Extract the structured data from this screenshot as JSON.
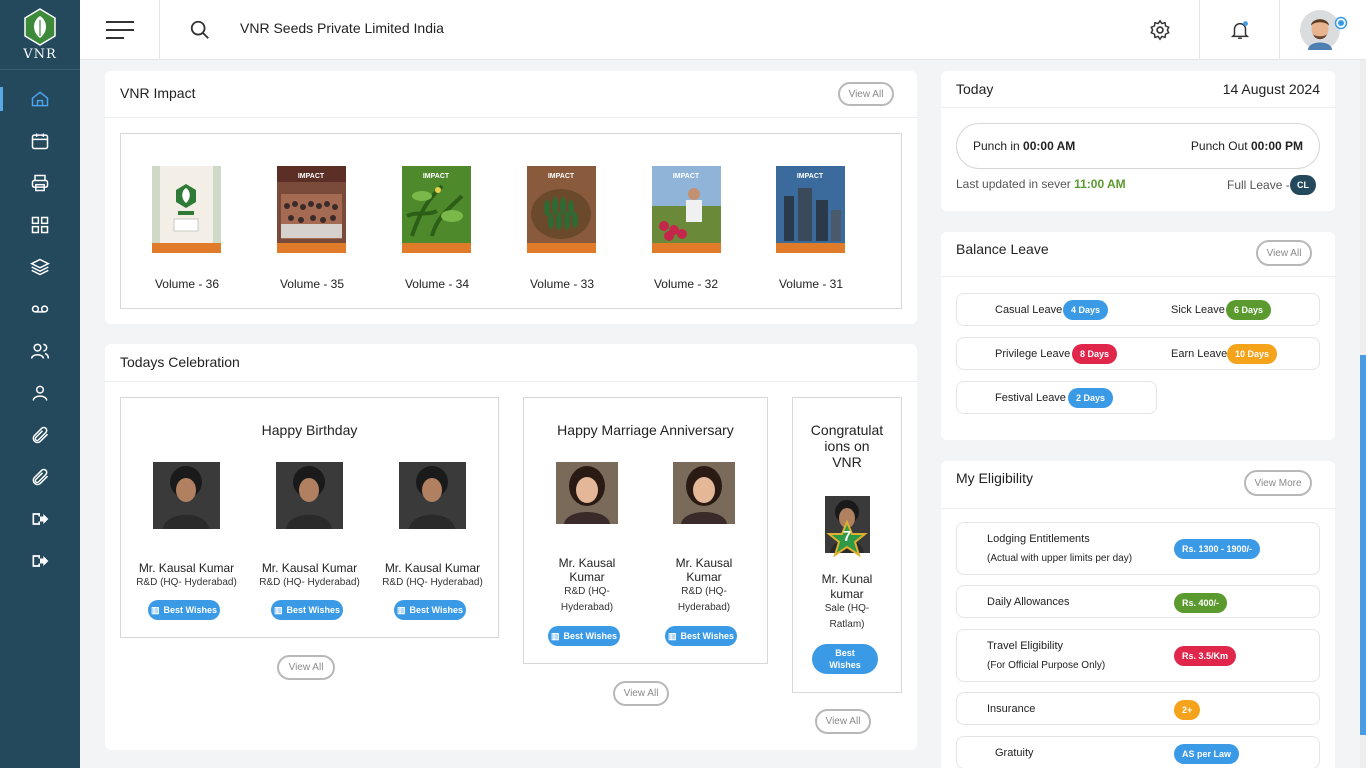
{
  "brand": {
    "logo_text": "VNR"
  },
  "header": {
    "company_name": "VNR Seeds Private Limited India"
  },
  "nav": [
    "home-icon",
    "calendar-icon",
    "printer-icon",
    "grid-icon",
    "layers-icon",
    "voicemail-icon",
    "users-icon",
    "user-icon",
    "paperclip-icon",
    "paperclip-icon",
    "logout-icon",
    "logout-icon"
  ],
  "impact": {
    "title": "VNR Impact",
    "view_all": "View All",
    "volumes": [
      {
        "label": "Volume - 36"
      },
      {
        "label": "Volume - 35"
      },
      {
        "label": "Volume - 34"
      },
      {
        "label": "Volume - 33"
      },
      {
        "label": "Volume - 32"
      },
      {
        "label": "Volume - 31"
      }
    ]
  },
  "celebration": {
    "title": "Todays Celebration",
    "birthday": {
      "heading": "Happy Birthday",
      "people": [
        {
          "name": "Mr. Kausal Kumar",
          "dept": "R&D (HQ- Hyderabad)",
          "action": "Best Wishes"
        },
        {
          "name": "Mr. Kausal Kumar",
          "dept": "R&D (HQ- Hyderabad)",
          "action": "Best Wishes"
        },
        {
          "name": "Mr. Kausal Kumar",
          "dept": "R&D (HQ- Hyderabad)",
          "action": "Best Wishes"
        }
      ],
      "view_all": "View All"
    },
    "anniversary": {
      "heading": "Happy Marriage Anniversary",
      "people": [
        {
          "name_l1": "Mr. Kausal",
          "name_l2": "Kumar",
          "dept_l1": "R&D (HQ-",
          "dept_l2": "Hyderabad)",
          "action": "Best Wishes"
        },
        {
          "name_l1": "Mr. Kausal",
          "name_l2": "Kumar",
          "dept_l1": "R&D (HQ-",
          "dept_l2": "Hyderabad)",
          "action": "Best Wishes"
        }
      ],
      "view_all": "View All"
    },
    "congrats": {
      "heading_l1": "Congratulat",
      "heading_l2": "ions on",
      "heading_l3": "VNR",
      "years": "7",
      "name_l1": "Mr. Kunal",
      "name_l2": "kumar",
      "dept_l1": "Sale (HQ-",
      "dept_l2": "Ratlam)",
      "action_l1": "Best",
      "action_l2": "Wishes",
      "view_all": "View All"
    }
  },
  "today": {
    "label": "Today",
    "date": "14 August 2024",
    "punch_in_label": "Punch in",
    "punch_in_time": "00:00 AM",
    "punch_out_label": "Punch Out",
    "punch_out_time": "00:00 PM",
    "last_updated_label": "Last updated in sever",
    "last_updated_time": "11:00 AM",
    "leave_status_label": "Full Leave -",
    "leave_status_code": "CL"
  },
  "balance_leave": {
    "title": "Balance Leave",
    "view_all": "View All",
    "casual": {
      "label": "Casual Leave",
      "value": "4 Days"
    },
    "sick": {
      "label": "Sick Leave",
      "value": "6 Days"
    },
    "privilege": {
      "label": "Privilege Leave",
      "value": "8 Days"
    },
    "earn": {
      "label": "Earn Leave",
      "value": "10 Days"
    },
    "festival": {
      "label": "Festival Leave",
      "value": "2 Days"
    }
  },
  "eligibility": {
    "title": "My Eligibility",
    "view_more": "View More",
    "lodging": {
      "label": "Lodging Entitlements",
      "sub": "(Actual with upper limits per day)",
      "value": "Rs. 1300 - 1900/-"
    },
    "daily": {
      "label": "Daily Allowances",
      "value": "Rs. 400/-"
    },
    "travel": {
      "label": "Travel Eligibility",
      "sub": "(For Official Purpose Only)",
      "value": "Rs. 3.5/Km"
    },
    "insurance": {
      "label": "Insurance",
      "value": "2+"
    },
    "gratuity": {
      "label": "Gratuity",
      "value": "AS per Law"
    }
  },
  "colors": {
    "sidebar": "#24485c",
    "accent_blue": "#3b9ae6",
    "green": "#5a9a2e",
    "red": "#e0274b",
    "orange": "#f5a31a"
  }
}
